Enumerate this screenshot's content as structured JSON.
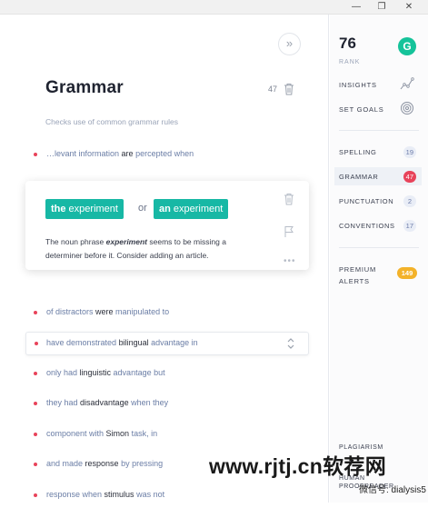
{
  "window": {
    "minimize": "—",
    "maximize": "❐",
    "close": "✕"
  },
  "editor": {
    "collapse_icon": "»",
    "title": "Grammar",
    "count": "47",
    "subtitle": "Checks use of common grammar rules",
    "items": [
      {
        "pre": "…levant information ",
        "bold": "are",
        "post": " percepted when"
      },
      {
        "pre": "of distractors ",
        "bold": "were",
        "post": " manipulated to"
      },
      {
        "pre": "have demonstrated ",
        "bold": "bilingual",
        "post": " advantage in"
      },
      {
        "pre": "only had ",
        "bold": "linguistic",
        "post": " advantage but"
      },
      {
        "pre": "they had ",
        "bold": "disadvantage",
        "post": " when they"
      },
      {
        "pre": "component with ",
        "bold": "Simon",
        "post": " task, in"
      },
      {
        "pre": "and made ",
        "bold": "response",
        "post": " by pressing"
      },
      {
        "pre": "response when ",
        "bold": "stimulus",
        "post": " was not"
      }
    ]
  },
  "card": {
    "suggestion1_bold": "the",
    "suggestion1_rest": " experiment",
    "or": "or",
    "suggestion2_bold": "an",
    "suggestion2_rest": " experiment",
    "msg_pre": "The noun phrase ",
    "msg_em": "experiment",
    "msg_post": " seems to be missing a determiner before it. Consider adding an article.",
    "more": "•••"
  },
  "sidebar": {
    "score": "76",
    "rank_label": "RANK",
    "logo": "G",
    "insights": "INSIGHTS",
    "set_goals": "SET GOALS",
    "categories": [
      {
        "label": "SPELLING",
        "count": "19"
      },
      {
        "label": "GRAMMAR",
        "count": "47"
      },
      {
        "label": "PUNCTUATION",
        "count": "2"
      },
      {
        "label": "CONVENTIONS",
        "count": "17"
      }
    ],
    "premium_line1": "PREMIUM",
    "premium_line2": "ALERTS",
    "premium_count": "149",
    "plagiarism": "PLAGIARISM",
    "human_line1": "HUMAN",
    "human_line2": "PROOFREADER"
  },
  "watermark": {
    "main": "www.rjtj.cn软荐网",
    "sub": "微信号: dialysis5"
  },
  "colors": {
    "accent": "#17b8a5",
    "alert": "#e8435a",
    "premium": "#f3b22a",
    "brand": "#15c39a"
  }
}
